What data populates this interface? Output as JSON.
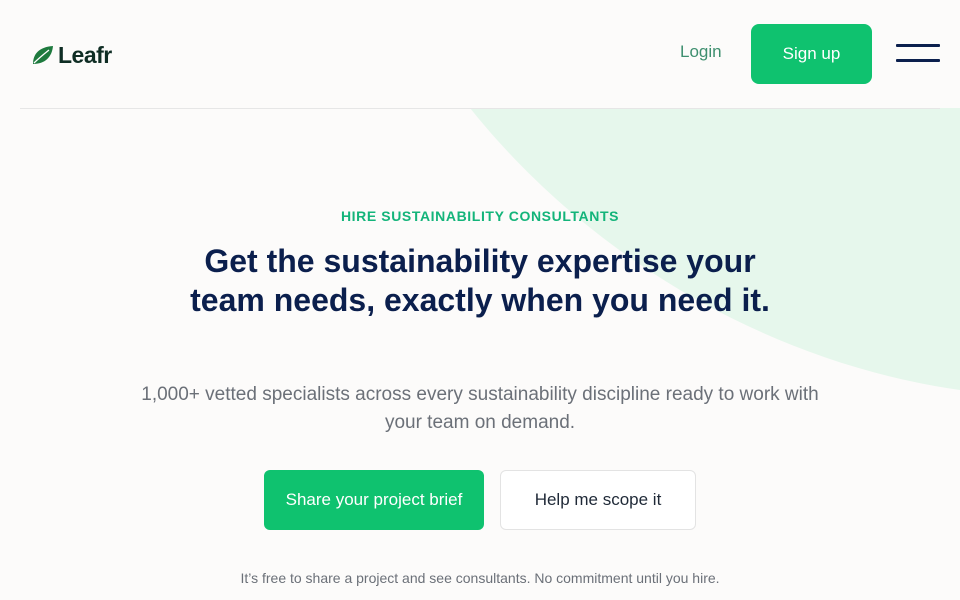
{
  "header": {
    "logo_text": "Leafr",
    "login_label": "Login",
    "signup_label": "Sign up"
  },
  "hero": {
    "eyebrow": "HIRE SUSTAINABILITY CONSULTANTS",
    "title": "Get the sustainability expertise your team needs, exactly when you need it.",
    "subtitle": "1,000+ vetted specialists across every sustainability discipline ready to work with your team on demand.",
    "primary_cta": "Share your project brief",
    "secondary_cta": "Help me scope it",
    "note": "It’s free to share a project and see consultants. No commitment until you hire."
  },
  "icons": {
    "logo": "leaf-icon",
    "menu": "hamburger-menu-icon"
  },
  "colors": {
    "accent": "#0fc26f",
    "heading": "#0b1f4d",
    "eyebrow": "#13b47a",
    "background_shape": "#e6f7ec"
  }
}
